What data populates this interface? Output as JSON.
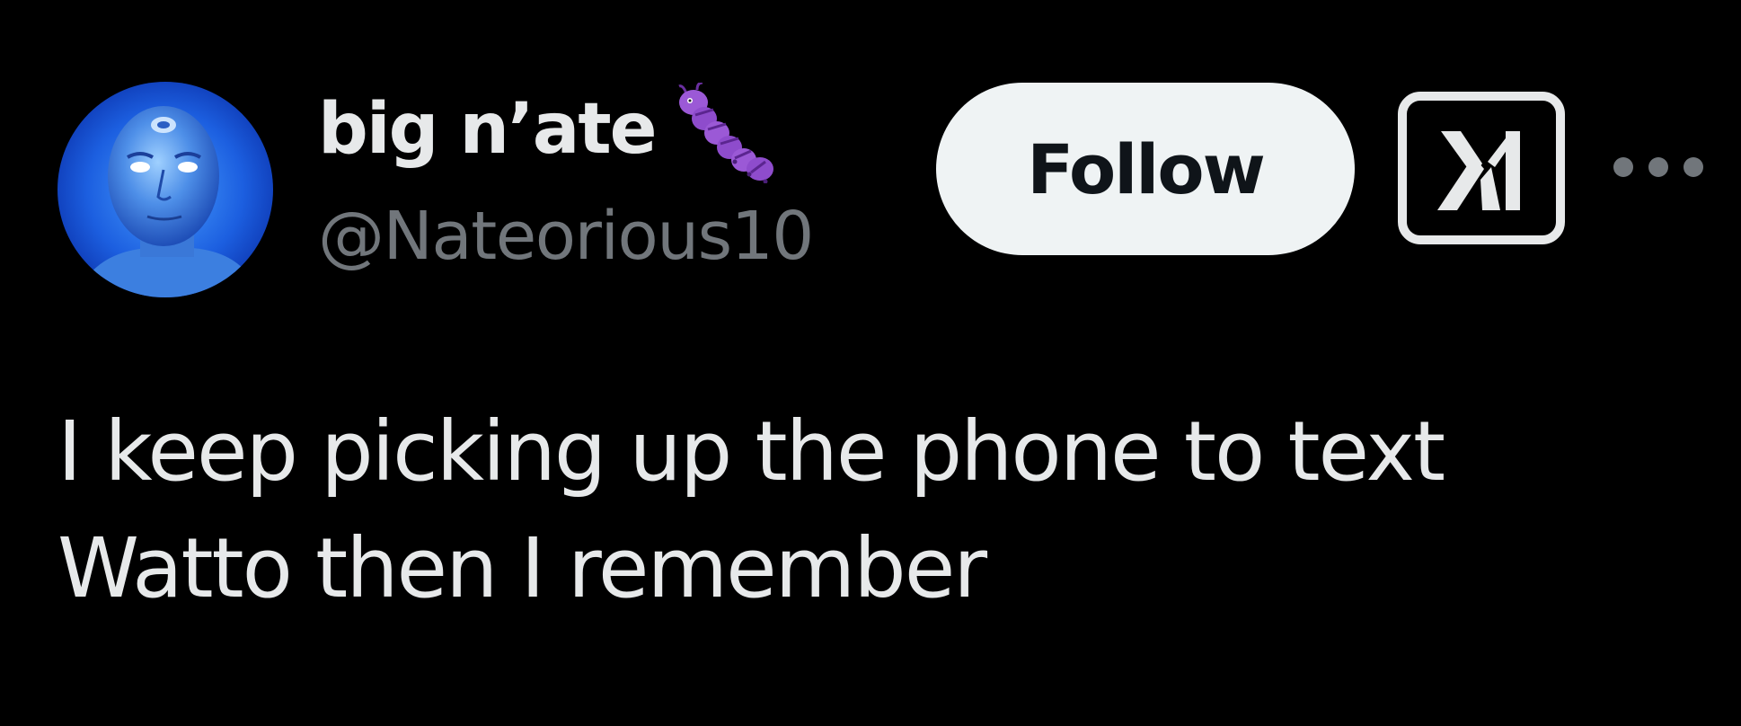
{
  "author": {
    "display_name": "big n’ate",
    "emoji_icon": "caterpillar-bug-emoji",
    "handle": "@Nateorious10",
    "avatar_icon": "blue-man-avatar"
  },
  "actions": {
    "follow_label": "Follow",
    "grok_icon": "x-ai-logo-icon",
    "more_icon": "more-options-icon"
  },
  "tweet": {
    "text_lines": [
      "I keep picking up the phone to text",
      "Watto then I remember"
    ]
  },
  "colors": {
    "background": "#000000",
    "primary_text": "#e7e9ea",
    "secondary_text": "#71767b",
    "follow_bg": "#eff3f4",
    "follow_text": "#0f1419",
    "emoji": "#9b59d6"
  }
}
